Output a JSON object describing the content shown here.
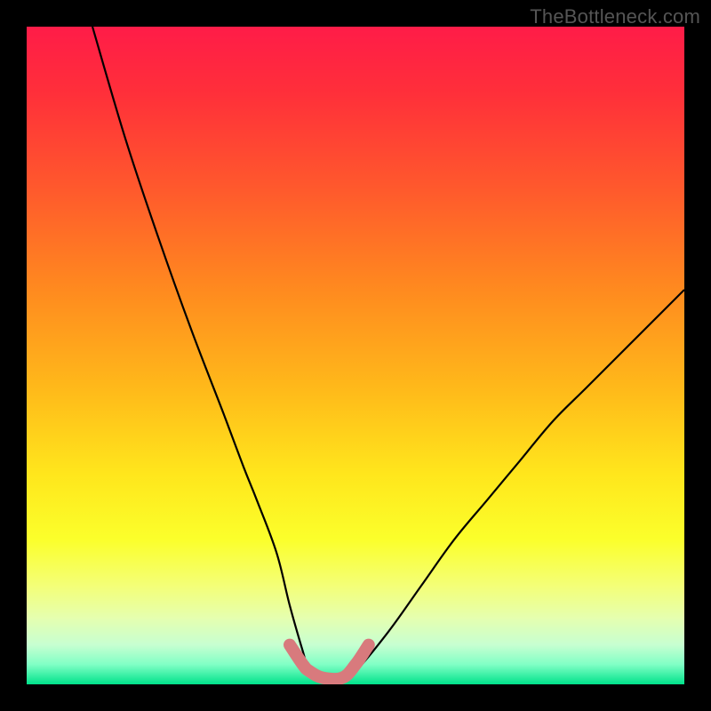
{
  "watermark": "TheBottleneck.com",
  "colors": {
    "frame": "#000000",
    "gradient_stops": [
      {
        "offset": 0.0,
        "color": "#ff1c48"
      },
      {
        "offset": 0.1,
        "color": "#ff2f3a"
      },
      {
        "offset": 0.25,
        "color": "#ff5a2c"
      },
      {
        "offset": 0.4,
        "color": "#ff8a1f"
      },
      {
        "offset": 0.55,
        "color": "#ffb91a"
      },
      {
        "offset": 0.68,
        "color": "#ffe61c"
      },
      {
        "offset": 0.78,
        "color": "#fbff2b"
      },
      {
        "offset": 0.85,
        "color": "#f4ff77"
      },
      {
        "offset": 0.9,
        "color": "#e5ffb0"
      },
      {
        "offset": 0.94,
        "color": "#c7ffd1"
      },
      {
        "offset": 0.97,
        "color": "#80ffc5"
      },
      {
        "offset": 1.0,
        "color": "#00e28a"
      }
    ],
    "curve": "#000000",
    "highlight": "#d87a7d"
  },
  "chart_data": {
    "type": "line",
    "title": "",
    "xlabel": "",
    "ylabel": "",
    "xlim": [
      0,
      100
    ],
    "ylim": [
      0,
      100
    ],
    "series": [
      {
        "name": "bottleneck-curve",
        "x": [
          10,
          15,
          20,
          25,
          30,
          33,
          35,
          38,
          40,
          42,
          43,
          45,
          48,
          50,
          55,
          60,
          65,
          70,
          75,
          80,
          85,
          90,
          95,
          100
        ],
        "y": [
          100,
          83,
          68,
          54,
          41,
          33,
          28,
          20,
          12,
          5,
          2,
          1,
          1,
          2,
          8,
          15,
          22,
          28,
          34,
          40,
          45,
          50,
          55,
          60
        ]
      },
      {
        "name": "optimal-range-highlight",
        "x": [
          40,
          42,
          43,
          45,
          48,
          50,
          52
        ],
        "y": [
          6,
          3,
          2,
          1,
          1,
          3,
          6
        ]
      }
    ],
    "legend": false,
    "grid": false
  }
}
